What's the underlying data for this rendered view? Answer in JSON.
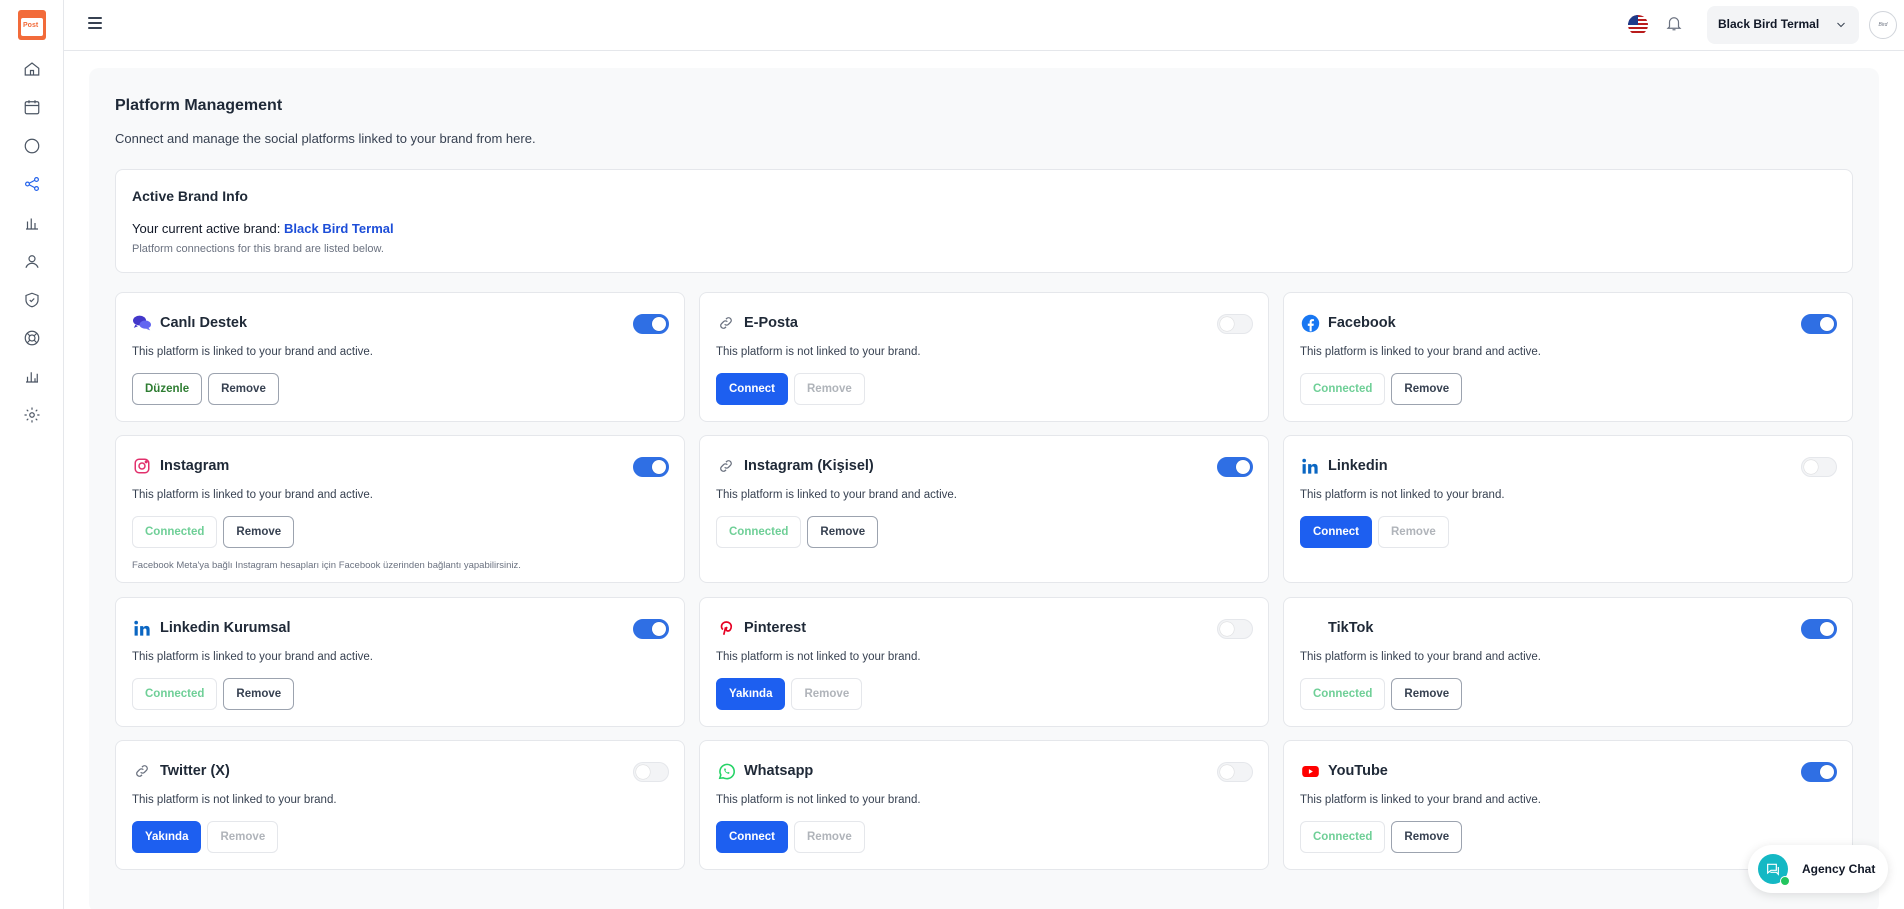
{
  "sidebar": {
    "logo_text": "Post",
    "items": [
      {
        "name": "home-icon",
        "active": false
      },
      {
        "name": "calendar-icon",
        "active": false
      },
      {
        "name": "chat-icon",
        "active": false
      },
      {
        "name": "share-icon",
        "active": true
      },
      {
        "name": "bar-chart-icon",
        "active": false
      },
      {
        "name": "user-icon",
        "active": false
      },
      {
        "name": "shield-icon",
        "active": false
      },
      {
        "name": "support-icon",
        "active": false
      },
      {
        "name": "analytics-icon",
        "active": false
      },
      {
        "name": "gear-icon",
        "active": false
      }
    ]
  },
  "topbar": {
    "brand_select": "Black Bird Termal",
    "avatar_text": "Bird"
  },
  "page": {
    "title": "Platform Management",
    "subtitle": "Connect and manage the social platforms linked to your brand from here."
  },
  "brand_info": {
    "heading": "Active Brand Info",
    "current_label": "Your current active brand:",
    "current_brand": "Black Bird Termal",
    "note": "Platform connections for this brand are listed below."
  },
  "platforms": [
    {
      "name": "Canlı Destek",
      "icon": "chat-bubbles-icon",
      "status": "This platform is linked to your brand and active.",
      "enabled": true,
      "buttons": [
        {
          "label": "Düzenle",
          "style": "edit"
        },
        {
          "label": "Remove",
          "style": "outline"
        }
      ],
      "extra": ""
    },
    {
      "name": "E-Posta",
      "icon": "link-icon",
      "status": "This platform is not linked to your brand.",
      "enabled": false,
      "buttons": [
        {
          "label": "Connect",
          "style": "primary"
        },
        {
          "label": "Remove",
          "style": "disabled"
        }
      ],
      "extra": ""
    },
    {
      "name": "Facebook",
      "icon": "facebook-icon",
      "status": "This platform is linked to your brand and active.",
      "enabled": true,
      "buttons": [
        {
          "label": "Connected",
          "style": "connected"
        },
        {
          "label": "Remove",
          "style": "outline"
        }
      ],
      "extra": ""
    },
    {
      "name": "Instagram",
      "icon": "instagram-icon",
      "status": "This platform is linked to your brand and active.",
      "enabled": true,
      "buttons": [
        {
          "label": "Connected",
          "style": "connected"
        },
        {
          "label": "Remove",
          "style": "outline"
        }
      ],
      "extra": "Facebook Meta'ya bağlı Instagram hesapları için Facebook üzerinden bağlantı yapabilirsiniz."
    },
    {
      "name": "Instagram (Kişisel)",
      "icon": "link-icon",
      "status": "This platform is linked to your brand and active.",
      "enabled": true,
      "buttons": [
        {
          "label": "Connected",
          "style": "connected"
        },
        {
          "label": "Remove",
          "style": "outline"
        }
      ],
      "extra": ""
    },
    {
      "name": "Linkedin",
      "icon": "linkedin-icon",
      "status": "This platform is not linked to your brand.",
      "enabled": false,
      "buttons": [
        {
          "label": "Connect",
          "style": "primary"
        },
        {
          "label": "Remove",
          "style": "disabled"
        }
      ],
      "extra": ""
    },
    {
      "name": "Linkedin Kurumsal",
      "icon": "linkedin-icon",
      "status": "This platform is linked to your brand and active.",
      "enabled": true,
      "buttons": [
        {
          "label": "Connected",
          "style": "connected"
        },
        {
          "label": "Remove",
          "style": "outline"
        }
      ],
      "extra": ""
    },
    {
      "name": "Pinterest",
      "icon": "pinterest-icon",
      "status": "This platform is not linked to your brand.",
      "enabled": false,
      "buttons": [
        {
          "label": "Yakında",
          "style": "primary"
        },
        {
          "label": "Remove",
          "style": "disabled"
        }
      ],
      "extra": ""
    },
    {
      "name": "TikTok",
      "icon": "tiktok-icon",
      "status": "This platform is linked to your brand and active.",
      "enabled": true,
      "buttons": [
        {
          "label": "Connected",
          "style": "connected"
        },
        {
          "label": "Remove",
          "style": "outline"
        }
      ],
      "extra": ""
    },
    {
      "name": "Twitter (X)",
      "icon": "link-icon",
      "status": "This platform is not linked to your brand.",
      "enabled": false,
      "buttons": [
        {
          "label": "Yakında",
          "style": "primary"
        },
        {
          "label": "Remove",
          "style": "disabled"
        }
      ],
      "extra": ""
    },
    {
      "name": "Whatsapp",
      "icon": "whatsapp-icon",
      "status": "This platform is not linked to your brand.",
      "enabled": false,
      "buttons": [
        {
          "label": "Connect",
          "style": "primary"
        },
        {
          "label": "Remove",
          "style": "disabled"
        }
      ],
      "extra": ""
    },
    {
      "name": "YouTube",
      "icon": "youtube-icon",
      "status": "This platform is linked to your brand and active.",
      "enabled": true,
      "buttons": [
        {
          "label": "Connected",
          "style": "connected"
        },
        {
          "label": "Remove",
          "style": "outline"
        }
      ],
      "extra": ""
    }
  ],
  "chat_widget": {
    "label": "Agency Chat"
  },
  "colors": {
    "accent": "#1d5ff0",
    "toggle_on": "#2f6fe4",
    "connected": "#6fcf97",
    "brand_link": "#1d4ed8"
  }
}
